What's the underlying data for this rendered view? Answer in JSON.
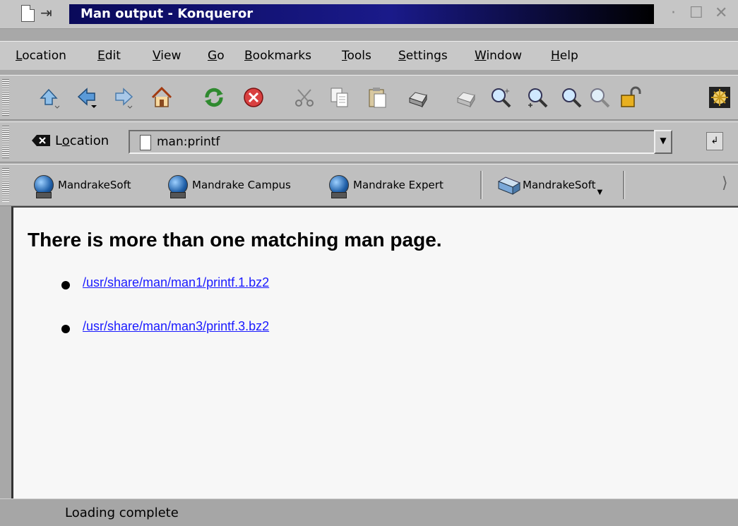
{
  "window": {
    "title": "Man output - Konqueror",
    "controls": {
      "minimize": "·",
      "maximize": "☐",
      "close": "✕"
    }
  },
  "menubar": {
    "items": [
      {
        "label": "Location",
        "key": "L",
        "rest": "ocation"
      },
      {
        "label": "Edit",
        "key": "E",
        "rest": "dit"
      },
      {
        "label": "View",
        "key": "V",
        "rest": "iew"
      },
      {
        "label": "Go",
        "key": "G",
        "rest": "o"
      },
      {
        "label": "Bookmarks",
        "key": "B",
        "rest": "ookmarks"
      },
      {
        "label": "Tools",
        "key": "T",
        "rest": "ools"
      },
      {
        "label": "Settings",
        "key": "S",
        "rest": "ettings"
      },
      {
        "label": "Window",
        "key": "W",
        "rest": "indow"
      },
      {
        "label": "Help",
        "key": "H",
        "rest": "elp"
      }
    ]
  },
  "toolbar": {
    "buttons": [
      "up-icon",
      "back-icon",
      "forward-icon",
      "home-icon",
      "reload-icon",
      "stop-icon",
      "cut-icon",
      "copy-icon",
      "paste-icon",
      "print-icon",
      "print-frame-icon",
      "find-icon",
      "zoom-in-icon",
      "zoom-out-icon",
      "zoom-reset-icon",
      "security-lock-icon",
      "konqueror-logo-icon"
    ]
  },
  "location": {
    "label_pre": "L",
    "label_key": "o",
    "label_post": "cation",
    "value": "man:printf"
  },
  "bookmarks": {
    "items": [
      {
        "label": "MandrakeSoft",
        "icon": "globe-icon"
      },
      {
        "label": "Mandrake Campus",
        "icon": "globe-icon"
      },
      {
        "label": "Mandrake Expert",
        "icon": "globe-icon"
      },
      {
        "label": "MandrakeSoft",
        "icon": "folder-icon"
      }
    ]
  },
  "content": {
    "heading": "There is more than one matching man page.",
    "links": [
      "/usr/share/man/man1/printf.1.bz2",
      "/usr/share/man/man3/printf.3.bz2"
    ]
  },
  "status": {
    "text": "Loading complete"
  },
  "colors": {
    "title_active": "#1a1a8a",
    "link": "#1a1aff",
    "content_bg": "#f7f7f7"
  }
}
